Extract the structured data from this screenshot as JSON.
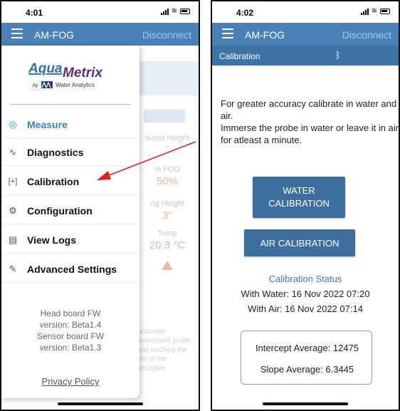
{
  "screen1": {
    "time": "4:01",
    "app_title": "AM-FOG",
    "disconnect": "Disconnect",
    "logo": {
      "brand": "AquaMetrix",
      "by": "by",
      "company": "Water Analytics"
    },
    "menu": [
      {
        "label": "Measure",
        "icon": "measure-icon",
        "glyph": "◎",
        "active": true
      },
      {
        "label": "Diagnostics",
        "icon": "pulse-icon",
        "glyph": "∿",
        "active": false
      },
      {
        "label": "Calibration",
        "icon": "calibration-icon",
        "glyph": "⌜+⌟",
        "active": false
      },
      {
        "label": "Configuration",
        "icon": "gear-icon",
        "glyph": "⚙",
        "active": false
      },
      {
        "label": "View Logs",
        "icon": "document-icon",
        "glyph": "▤",
        "active": false
      },
      {
        "label": "Advanced Settings",
        "icon": "wrench-icon",
        "glyph": "🔧",
        "active": false
      }
    ],
    "fw": {
      "head_label": "Head board FW",
      "head_version": "version: Beta1.4",
      "sensor_label": "Sensor board FW",
      "sensor_version": "version: Beta1.3"
    },
    "privacy": "Privacy Policy",
    "background": {
      "measured_height_label": "sured Height",
      "measured_height_value": "\"",
      "fog_label": "% FOG",
      "fog_value": "50%",
      "fog_height_label": "og Height",
      "fog_height_value": "3\"",
      "temp_label": "Temp",
      "temp_value": "20.3 °C",
      "note": "r accurate easurement probe must ouching the ttom of the nterceptor"
    }
  },
  "screen2": {
    "time": "4:02",
    "app_title": "AM-FOG",
    "disconnect": "Disconnect",
    "section_title": "Calibration",
    "bluetooth_icon": "bluetooth-icon",
    "instructions_1": "For greater accuracy calibrate in water and air.",
    "instructions_2": "Immerse the probe in water or leave it in air for atleast a minute.",
    "water_button": "WATER CALIBRATION",
    "air_button": "AIR CALIBRATION",
    "status_title": "Calibration Status",
    "with_water": "With Water: 16 Nov 2022 07:20",
    "with_air": "With Air: 16 Nov 2022 07:14",
    "intercept": "Intercept Average: 12475",
    "slope": "Slope Average: 6.3445"
  },
  "colors": {
    "appbar": "#4a82b8",
    "subbar": "#3f73a5",
    "button": "#3d6f9e",
    "accent": "#3b7fc4",
    "arrow": "#e02020"
  }
}
